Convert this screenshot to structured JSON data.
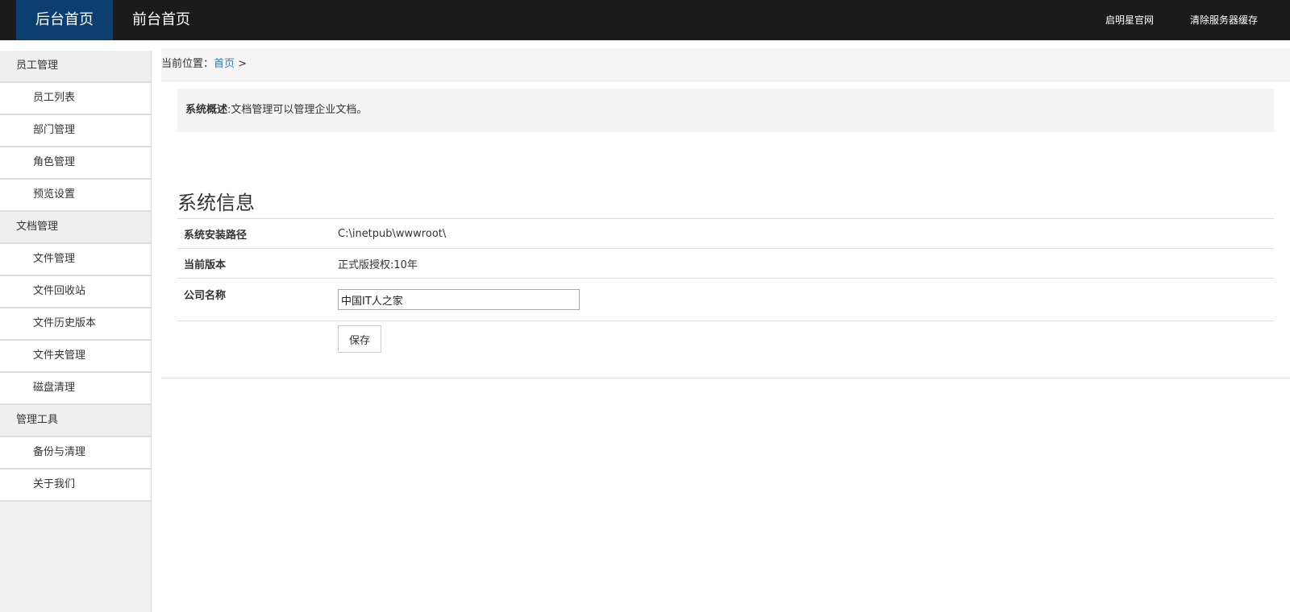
{
  "topbar": {
    "tabs": [
      {
        "label": "后台首页",
        "active": true
      },
      {
        "label": "前台首页",
        "active": false
      }
    ],
    "links": [
      "启明星官网",
      "清除服务器缓存"
    ],
    "colors": {
      "background": "#1b1b1b",
      "active_tab": "#0d3e70"
    }
  },
  "sidebar": {
    "groups": [
      {
        "label": "员工管理",
        "items": [
          "员工列表",
          "部门管理",
          "角色管理",
          "预览设置"
        ]
      },
      {
        "label": "文档管理",
        "items": [
          "文件管理",
          "文件回收站",
          "文件历史版本",
          "文件夹管理",
          "磁盘清理"
        ]
      },
      {
        "label": "管理工具",
        "items": [
          "备份与清理",
          "关于我们"
        ]
      }
    ]
  },
  "breadcrumb": {
    "prefix": "当前位置：",
    "home": "首页",
    "separator": " >"
  },
  "summary": {
    "label": "系统概述",
    "text": ":文档管理可以管理企业文档。"
  },
  "system_info": {
    "title": "系统信息",
    "install_path_label": "系统安装路径",
    "install_path_value": "C:\\inetpub\\wwwroot\\",
    "version_label": "当前版本",
    "version_value": "正式版授权:10年",
    "company_label": "公司名称",
    "company_value": "中国IT人之家",
    "save_label": "保存"
  }
}
